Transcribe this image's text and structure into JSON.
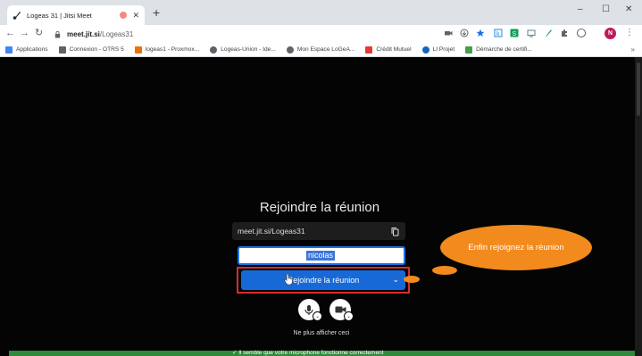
{
  "browser": {
    "tab_title": "Logeas 31 | Jitsi Meet",
    "tab_close": "✕",
    "new_tab": "+",
    "window_controls": {
      "minimize": "–",
      "maximize": "☐",
      "close": "✕"
    },
    "url_host": "meet.jit.si",
    "url_path": "/Logeas31",
    "profile_initial": "N",
    "bookmarks": [
      {
        "label": "Applications",
        "color": "#4285f4"
      },
      {
        "label": "Connexion - OTRS 5",
        "color": "#5f6368"
      },
      {
        "label": "logeas1 - Proxmox...",
        "color": "#e8710a"
      },
      {
        "label": "Logeas-Union - Ide...",
        "color": "#5f6368"
      },
      {
        "label": "Mon Espace LoGeA...",
        "color": "#5f6368"
      },
      {
        "label": "Crédit Mutuel",
        "color": "#e53935"
      },
      {
        "label": "LI Projet",
        "color": "#1565c0"
      },
      {
        "label": "Démarche de certifi...",
        "color": "#43a047"
      }
    ],
    "bookmarks_more": "»"
  },
  "meeting": {
    "title": "Rejoindre la réunion",
    "room_url": "meet.jit.si/Logeas31",
    "name_value": "nicolas",
    "join_button": "Rejoindre la réunion",
    "dont_show": "Ne plus afficher ceci",
    "mic_status": "✓ Il semble que votre microphone fonctionne correctement"
  },
  "annotation": {
    "bubble_text": "Enfin rejoignez la réunion",
    "color": "#f28a1d"
  },
  "colors": {
    "join_blue": "#1769d8",
    "highlight_red": "#d32f2f",
    "status_green": "#2f8b3b"
  }
}
